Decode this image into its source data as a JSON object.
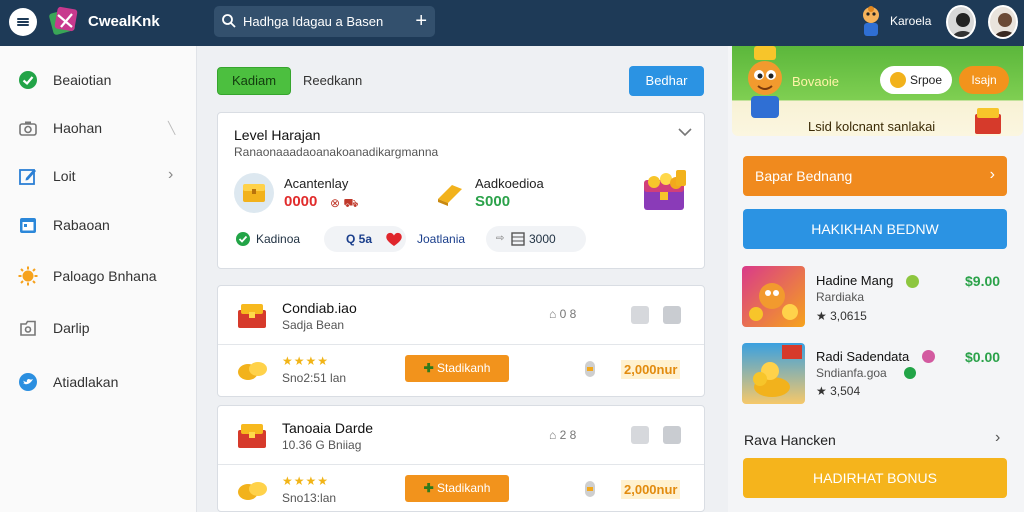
{
  "header": {
    "app_name": "CwealKnk",
    "search": {
      "value": "Hadhga Idagau a Basen",
      "placeholder": ""
    },
    "user_name": "Karoela"
  },
  "sidebar": {
    "items": [
      {
        "label": "Beaiotian",
        "icon": "check-circle-icon"
      },
      {
        "label": "Haohan",
        "icon": "camera-icon"
      },
      {
        "label": "Loit",
        "icon": "edit-icon"
      },
      {
        "label": "Rabaoan",
        "icon": "calendar-icon"
      },
      {
        "label": "Paloago Bnhana",
        "icon": "sun-icon"
      },
      {
        "label": "Darlip",
        "icon": "folder-icon"
      },
      {
        "label": "Atiadlakan",
        "icon": "bird-icon"
      }
    ]
  },
  "main": {
    "tabs": [
      {
        "label": "Kadiam",
        "active": true
      },
      {
        "label": "Reedkann",
        "active": false
      }
    ],
    "action_button": "Bedhar",
    "level_card": {
      "title": "Level Harajan",
      "subtitle": "Ranaonaaadaoanakoanadikargmanna",
      "stat1": {
        "label": "Acantenlay",
        "value": "0000",
        "suffix": "⊗ ⛟"
      },
      "stat2": {
        "label": "Aadkoedioa",
        "value": "S000"
      },
      "tags": [
        {
          "icon": "check-circle-icon",
          "label": "Kadinoa"
        },
        {
          "label": "Q 5a",
          "icon": "heart-icon"
        },
        {
          "label": "Joatlania"
        },
        {
          "label": "3000",
          "icon": "film-icon"
        }
      ]
    },
    "items": [
      {
        "title": "Condiab.iao",
        "subtitle": "Sadja Bean",
        "meta": "⌂ 0 8",
        "rating_stars": 4,
        "rating_text": "Sno2:51 lan",
        "button_label": "Stadikanh",
        "amount": "2,000nur"
      },
      {
        "title": "Tanoaia Darde",
        "subtitle": "10.36 G Bniiag",
        "meta": "⌂ 2 8",
        "rating_stars": 4,
        "rating_text": "Sno13:lan",
        "button_label": "Stadikanh",
        "amount": "2,000nur"
      }
    ]
  },
  "right": {
    "banner": {
      "title": "Bovaoie",
      "pill_white": "Srpoe",
      "pill_orange": "Isajn",
      "caption": "Lsid kolcnant sanlakai"
    },
    "button_orange": "Bapar Bednang",
    "button_blue": "HAKIKHAN BEDNW",
    "products": [
      {
        "title": "Hadine Mang",
        "subtitle": "Rardiaka",
        "price": "$9.00",
        "rating": "★ 3,0615"
      },
      {
        "title": "Radi Sadendata",
        "subtitle": "Sndianfa.goa",
        "price": "$0.00",
        "rating": "★ 3,504"
      }
    ],
    "section_link": "Rava Hancken",
    "button_yellow": "HADIRHAT BONUS"
  },
  "colors": {
    "topbar": "#1e3a57",
    "accent_green": "#4cbf3f",
    "accent_blue": "#2b93e3",
    "accent_orange": "#f2931c",
    "gold_text": "#e28b0e",
    "price_green": "#2ba24a"
  }
}
